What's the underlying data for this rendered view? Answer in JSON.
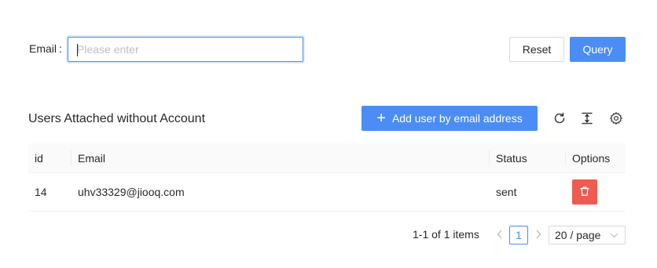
{
  "search": {
    "email_label": "Email",
    "email_colon": ":",
    "email_placeholder": "Please enter",
    "email_value": "",
    "reset_label": "Reset",
    "query_label": "Query"
  },
  "toolbar": {
    "title": "Users Attached without Account",
    "add_label": "Add user by email address",
    "icons": [
      "reload-icon",
      "column-height-icon",
      "setting-icon"
    ]
  },
  "table": {
    "columns": [
      "id",
      "Email",
      "Status",
      "Options"
    ],
    "rows": [
      {
        "id": "14",
        "email": "uhv33329@jiooq.com",
        "status": "sent",
        "option_icon": "delete-icon"
      }
    ]
  },
  "pagination": {
    "total_text": "1-1 of 1 items",
    "current_page": "1",
    "page_size": "20 / page"
  },
  "colors": {
    "primary": "#4b8df5",
    "danger": "#f05a4f",
    "header_bg": "#fafafa"
  }
}
